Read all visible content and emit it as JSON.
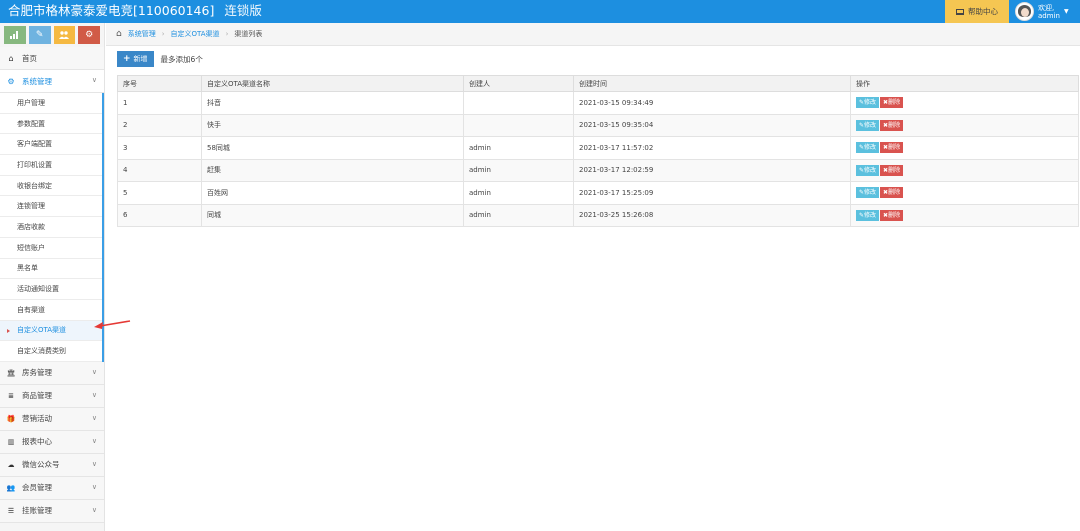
{
  "header": {
    "store_name": "合肥市格林豪泰爱电竞[110060146]",
    "edition": "连锁版",
    "help_label": "帮助中心",
    "welcome": "欢迎,",
    "username": "admin"
  },
  "colors": {
    "topbar": "#1d8fe0",
    "help": "#f5c652",
    "shortcut_green": "#87b87f",
    "shortcut_blue": "#6fb3e0",
    "shortcut_yellow": "#f5b942",
    "shortcut_red": "#d15b47",
    "edit": "#5bc0de",
    "delete": "#d9534f"
  },
  "shortcuts": [
    {
      "icon": "signal-icon"
    },
    {
      "icon": "pencil-icon"
    },
    {
      "icon": "users-icon"
    },
    {
      "icon": "cogs-icon"
    }
  ],
  "sidebar": {
    "home": "首页",
    "system_section": "系统管理",
    "system_items": [
      "用户管理",
      "参数配置",
      "客户端配置",
      "打印机设置",
      "收银台绑定",
      "连锁管理",
      "酒店收款",
      "短信账户",
      "黑名单",
      "活动通知设置",
      "自有渠道",
      "自定义OTA渠道",
      "自定义消费类别"
    ],
    "current_item": "自定义OTA渠道",
    "sections": [
      {
        "label": "房务管理",
        "icon": "bank-icon"
      },
      {
        "label": "商品管理",
        "icon": "database-icon"
      },
      {
        "label": "营销活动",
        "icon": "gift-icon"
      },
      {
        "label": "报表中心",
        "icon": "bar-chart-icon"
      },
      {
        "label": "微信公众号",
        "icon": "cloud-icon"
      },
      {
        "label": "会员管理",
        "icon": "group-icon"
      },
      {
        "label": "挂账管理",
        "icon": "list-icon"
      }
    ]
  },
  "breadcrumb": {
    "home_label": "系统管理",
    "parent": "自定义OTA渠道",
    "current": "渠道列表"
  },
  "toolbar": {
    "add_label": "新增",
    "note": "最多添加6个"
  },
  "table": {
    "headers": [
      "序号",
      "自定义OTA渠道名称",
      "创建人",
      "创建时间",
      "操作"
    ],
    "edit_label": "修改",
    "delete_label": "删除",
    "rows": [
      {
        "no": "1",
        "name": "抖音",
        "creator": "",
        "time": "2021-03-15 09:34:49"
      },
      {
        "no": "2",
        "name": "快手",
        "creator": "",
        "time": "2021-03-15 09:35:04"
      },
      {
        "no": "3",
        "name": "58同城",
        "creator": "admin",
        "time": "2021-03-17 11:57:02"
      },
      {
        "no": "4",
        "name": "赶集",
        "creator": "admin",
        "time": "2021-03-17 12:02:59"
      },
      {
        "no": "5",
        "name": "百姓网",
        "creator": "admin",
        "time": "2021-03-17 15:25:09"
      },
      {
        "no": "6",
        "name": "同城",
        "creator": "admin",
        "time": "2021-03-25 15:26:08"
      }
    ]
  }
}
